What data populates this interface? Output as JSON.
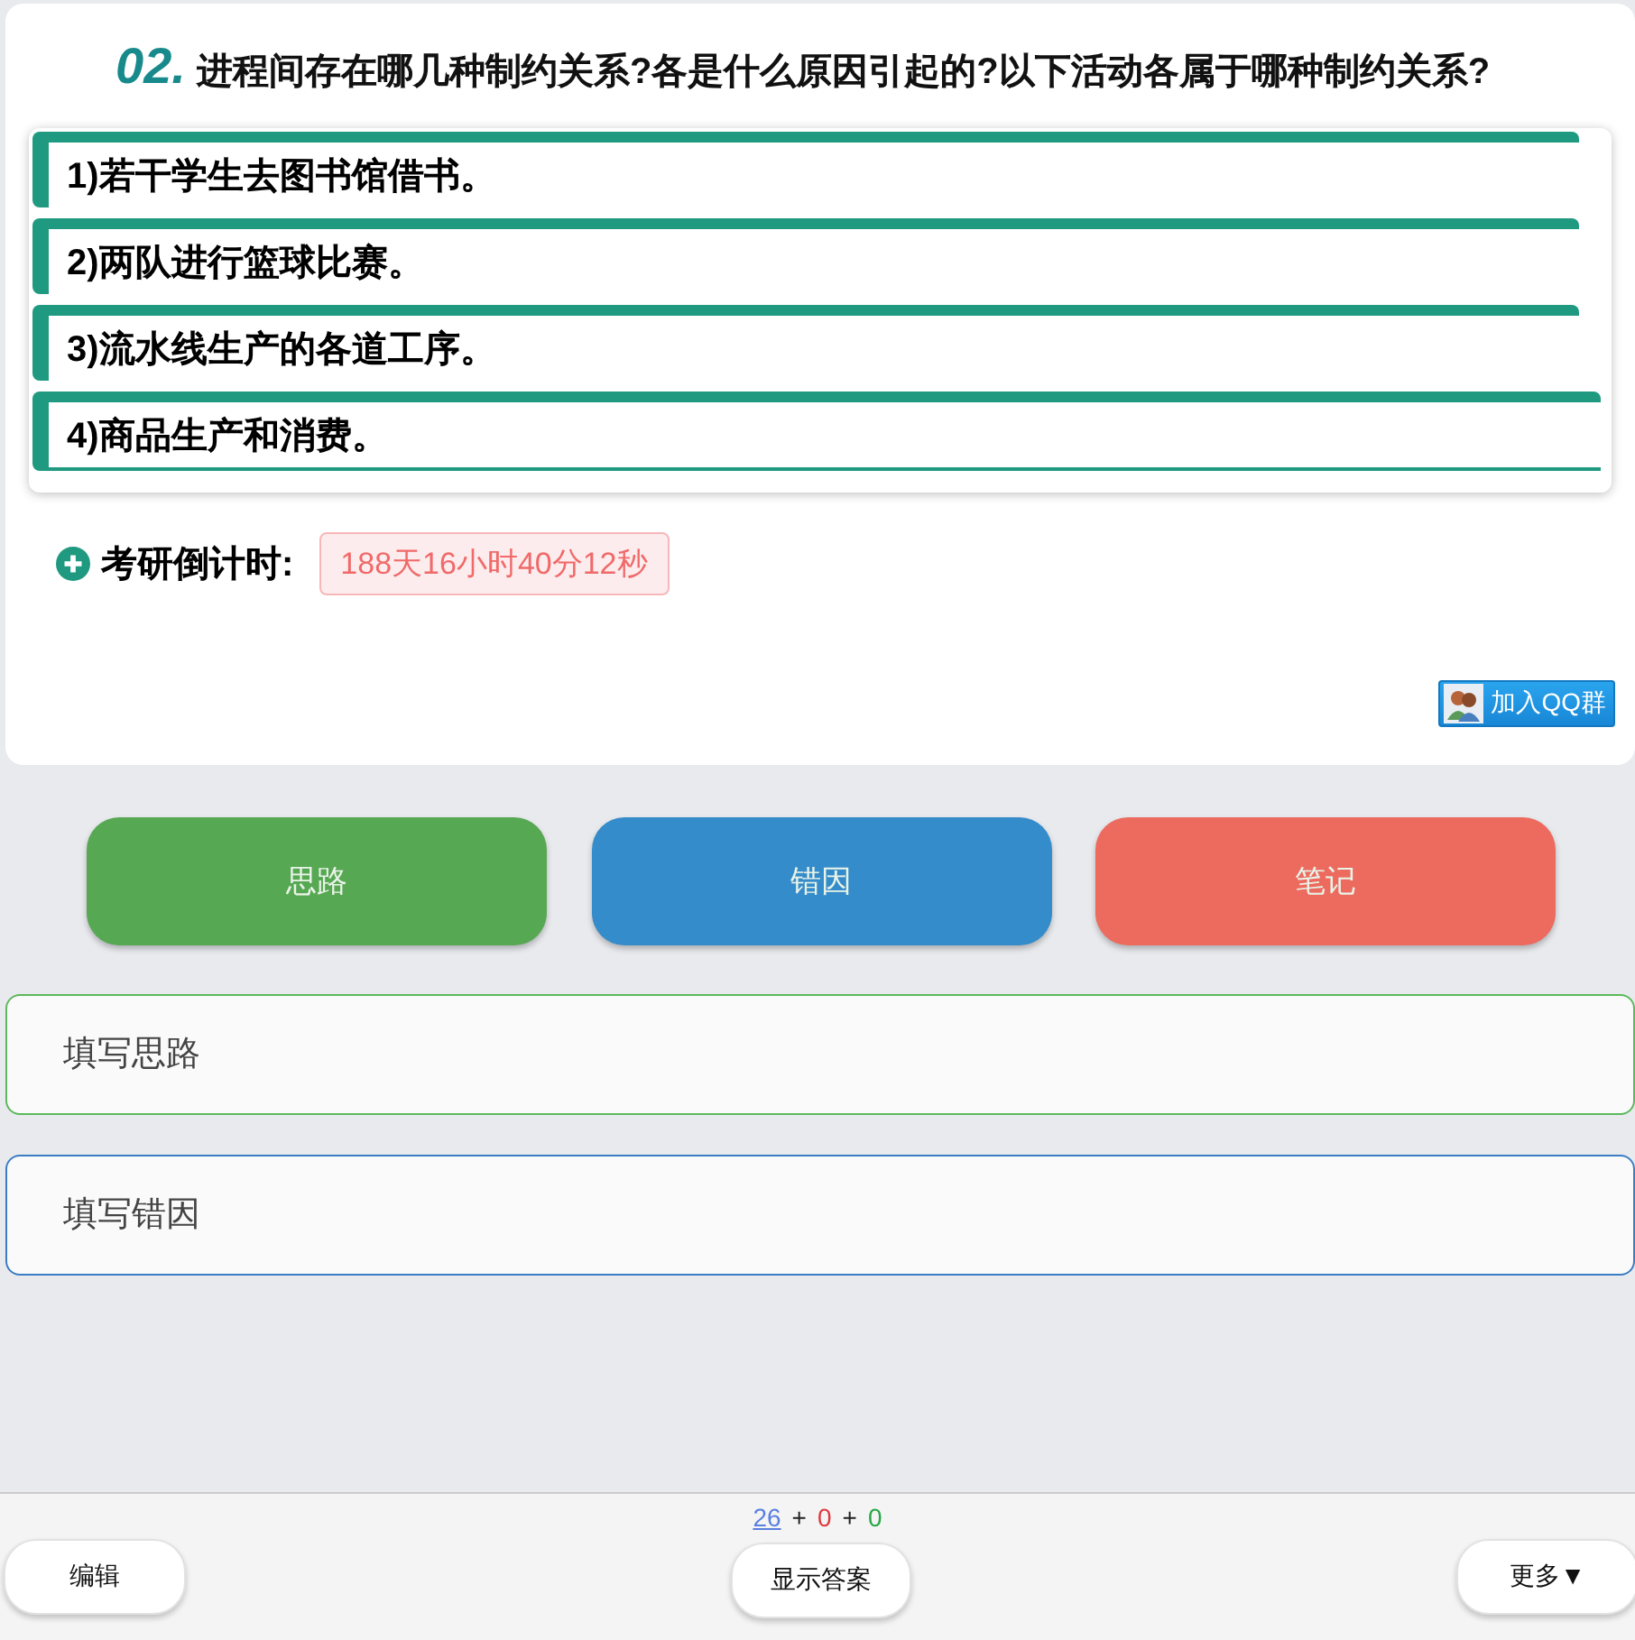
{
  "question": {
    "number": "02.",
    "text": "进程间存在哪几种制约关系?各是什么原因引起的?以下活动各属于哪种制约关系?"
  },
  "items": [
    "1)若干学生去图书馆借书。",
    "2)两队进行篮球比赛。",
    "3)流水线生产的各道工序。",
    "4)商品生产和消费。"
  ],
  "countdown": {
    "label": "考研倒计时:",
    "value": "188天16小时40分12秒"
  },
  "qq_button": "加入QQ群",
  "tabs": [
    {
      "label": "思路",
      "color": "#57a853"
    },
    {
      "label": "错因",
      "color": "#358cca"
    },
    {
      "label": "笔记",
      "color": "#ec6b5e"
    }
  ],
  "fields": [
    {
      "placeholder": "填写思路",
      "color": "#5cb85c"
    },
    {
      "placeholder": "填写错因",
      "color": "#3b7dc4"
    }
  ],
  "stats": [
    {
      "text": "26",
      "kind": "link",
      "color": "#5b7fe0"
    },
    {
      "text": "+",
      "kind": "plain",
      "color": "#222222"
    },
    {
      "text": "0",
      "kind": "plain",
      "color": "#e0393e"
    },
    {
      "text": "+",
      "kind": "plain",
      "color": "#222222"
    },
    {
      "text": "0",
      "kind": "plain",
      "color": "#28a745"
    }
  ],
  "footer_buttons": [
    "编辑",
    "显示答案",
    "更多▼"
  ]
}
